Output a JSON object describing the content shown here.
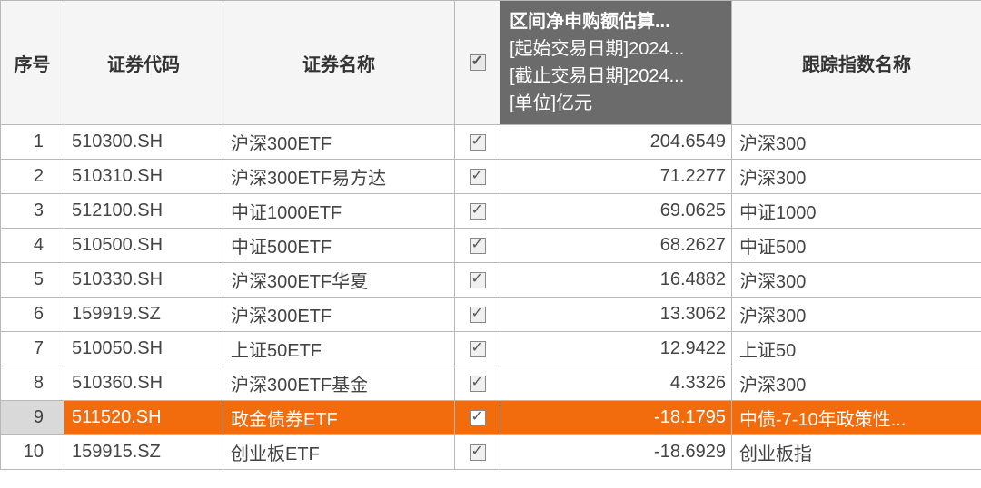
{
  "headers": {
    "num": "序号",
    "code": "证券代码",
    "name": "证券名称",
    "check": "",
    "value_title": "区间净申购额估算...",
    "value_line1": "[起始交易日期]2024...",
    "value_line2": "[截止交易日期]2024...",
    "value_line3": "[单位]亿元",
    "index": "跟踪指数名称"
  },
  "rows": [
    {
      "num": "1",
      "code": "510300.SH",
      "name": "沪深300ETF",
      "checked": true,
      "value": "204.6549",
      "index": "沪深300",
      "highlight": false
    },
    {
      "num": "2",
      "code": "510310.SH",
      "name": "沪深300ETF易方达",
      "checked": true,
      "value": "71.2277",
      "index": "沪深300",
      "highlight": false
    },
    {
      "num": "3",
      "code": "512100.SH",
      "name": "中证1000ETF",
      "checked": true,
      "value": "69.0625",
      "index": "中证1000",
      "highlight": false
    },
    {
      "num": "4",
      "code": "510500.SH",
      "name": "中证500ETF",
      "checked": true,
      "value": "68.2627",
      "index": "中证500",
      "highlight": false
    },
    {
      "num": "5",
      "code": "510330.SH",
      "name": "沪深300ETF华夏",
      "checked": true,
      "value": "16.4882",
      "index": "沪深300",
      "highlight": false
    },
    {
      "num": "6",
      "code": "159919.SZ",
      "name": "沪深300ETF",
      "checked": true,
      "value": "13.3062",
      "index": "沪深300",
      "highlight": false
    },
    {
      "num": "7",
      "code": "510050.SH",
      "name": "上证50ETF",
      "checked": true,
      "value": "12.9422",
      "index": "上证50",
      "highlight": false
    },
    {
      "num": "8",
      "code": "510360.SH",
      "name": "沪深300ETF基金",
      "checked": true,
      "value": "4.3326",
      "index": "沪深300",
      "highlight": false
    },
    {
      "num": "9",
      "code": "511520.SH",
      "name": "政金债券ETF",
      "checked": true,
      "value": "-18.1795",
      "index": "中债-7-10年政策性...",
      "highlight": true
    },
    {
      "num": "10",
      "code": "159915.SZ",
      "name": "创业板ETF",
      "checked": true,
      "value": "-18.6929",
      "index": "创业板指",
      "highlight": false
    }
  ]
}
